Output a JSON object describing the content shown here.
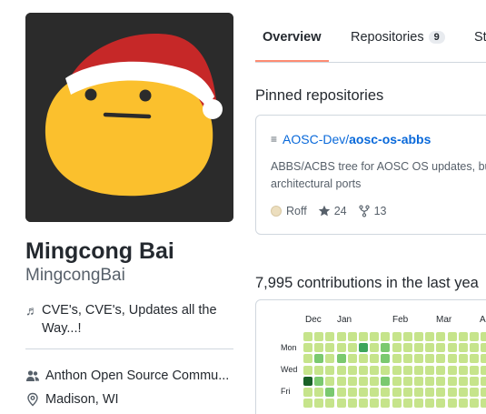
{
  "profile": {
    "fullname": "Mingcong Bai",
    "username": "MingcongBai",
    "bio": "CVE's, CVE's, Updates all the Way...!",
    "organization": "Anthon Open Source Commu...",
    "location": "Madison, WI"
  },
  "tabs": [
    {
      "label": "Overview",
      "active": true
    },
    {
      "label": "Repositories",
      "count": "9"
    },
    {
      "label": "St"
    }
  ],
  "pinned": {
    "title": "Pinned repositories",
    "repo": {
      "owner": "AOSC-Dev/",
      "name": "aosc-os-abbs",
      "description_line1": "ABBS/ACBS tree for AOSC OS updates, bui",
      "description_line2": "architectural ports",
      "language": "Roff",
      "language_color": "#ecdebe",
      "stars": "24",
      "forks": "13"
    }
  },
  "contributions": {
    "title": "7,995 contributions in the last yea",
    "months": [
      "Dec",
      "Jan",
      "Feb",
      "Mar",
      "A"
    ],
    "days": [
      "Mon",
      "Wed",
      "Fri"
    ],
    "levels": [
      [
        1,
        1,
        1,
        1,
        1,
        1,
        1,
        1,
        1,
        1,
        1,
        1,
        1,
        1,
        1,
        1,
        1
      ],
      [
        1,
        1,
        1,
        1,
        1,
        3,
        1,
        2,
        1,
        1,
        1,
        1,
        1,
        1,
        1,
        1,
        1
      ],
      [
        1,
        2,
        1,
        2,
        1,
        1,
        1,
        2,
        1,
        1,
        1,
        1,
        1,
        1,
        1,
        1,
        1
      ],
      [
        1,
        1,
        1,
        1,
        1,
        1,
        1,
        1,
        1,
        1,
        1,
        1,
        1,
        1,
        1,
        1,
        1
      ],
      [
        4,
        2,
        1,
        1,
        1,
        1,
        1,
        2,
        1,
        1,
        1,
        1,
        1,
        1,
        1,
        1,
        1
      ],
      [
        1,
        1,
        2,
        1,
        1,
        1,
        1,
        1,
        1,
        1,
        1,
        1,
        1,
        1,
        1,
        1,
        1
      ],
      [
        1,
        1,
        1,
        1,
        1,
        1,
        1,
        1,
        1,
        1,
        1,
        1,
        1,
        1,
        1,
        1,
        1
      ]
    ],
    "level_colors": [
      "#ebedf0",
      "#c6e48b",
      "#7bc96f",
      "#3ca55a",
      "#196127"
    ]
  },
  "icons": {
    "bio": "music-note-icon",
    "organization": "people-icon",
    "location": "location-pin-icon",
    "repo": "repo-icon",
    "star": "star-icon",
    "fork": "fork-icon"
  }
}
